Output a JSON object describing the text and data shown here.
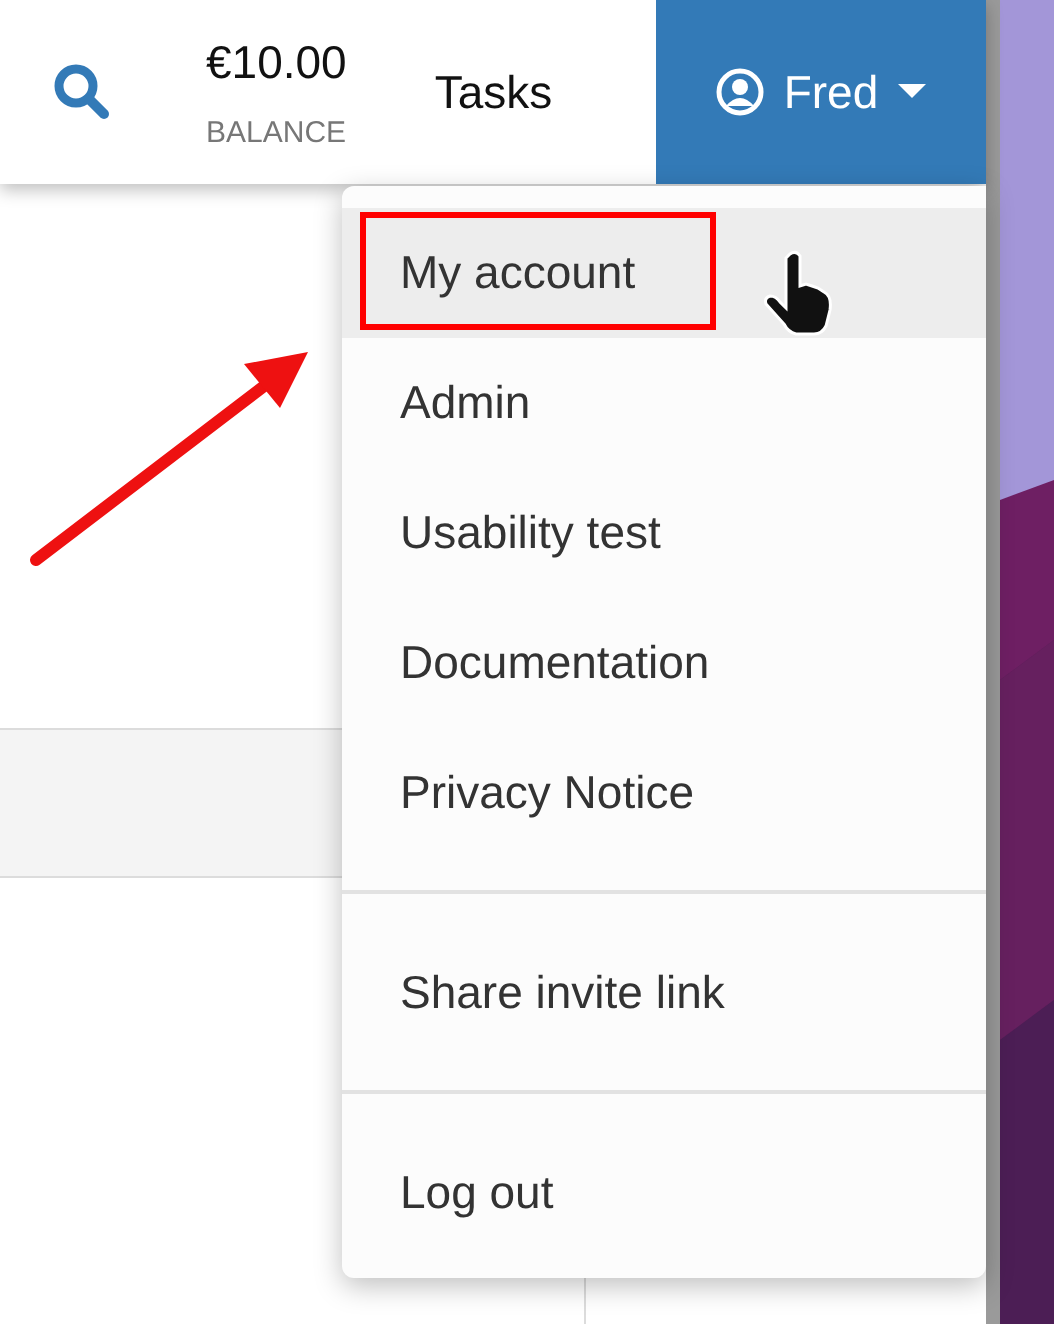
{
  "header": {
    "balance": {
      "amount": "€10.00",
      "label": "BALANCE"
    },
    "tasks_link": "Tasks",
    "user_button": {
      "name": "Fred",
      "expanded": true
    }
  },
  "user_menu": {
    "sections": [
      [
        {
          "label": "My account",
          "selected": true
        },
        {
          "label": "Admin",
          "selected": false
        },
        {
          "label": "Usability test",
          "selected": false
        },
        {
          "label": "Documentation",
          "selected": false
        },
        {
          "label": "Privacy Notice",
          "selected": false
        }
      ],
      [
        {
          "label": "Share invite link",
          "selected": false
        }
      ],
      [
        {
          "label": "Log out",
          "selected": false
        }
      ]
    ]
  }
}
